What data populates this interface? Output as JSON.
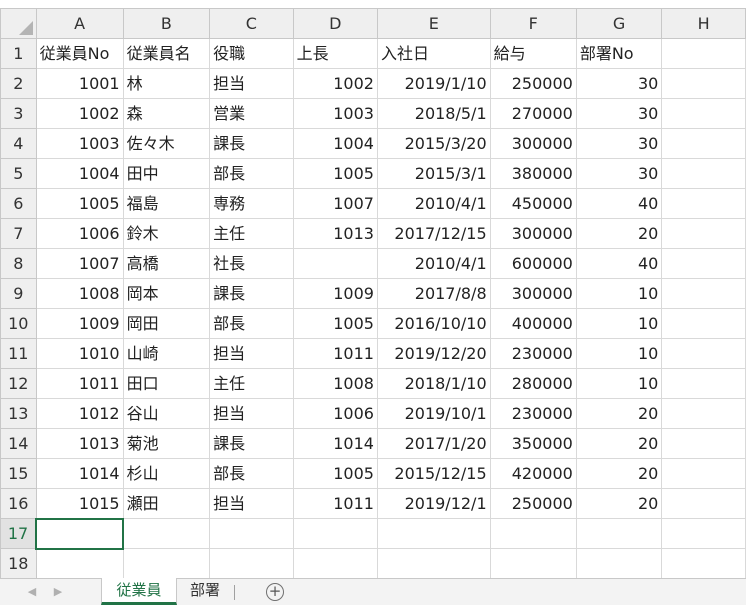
{
  "columns": [
    "A",
    "B",
    "C",
    "D",
    "E",
    "F",
    "G",
    "H"
  ],
  "rows": [
    {
      "num": "1",
      "cells": [
        "従業員No",
        "従業員名",
        "役職",
        "上長",
        "入社日",
        "給与",
        "部署No",
        ""
      ]
    },
    {
      "num": "2",
      "cells": [
        "1001",
        "林",
        "担当",
        "1002",
        "2019/1/10",
        "250000",
        "30",
        ""
      ]
    },
    {
      "num": "3",
      "cells": [
        "1002",
        "森",
        "営業",
        "1003",
        "2018/5/1",
        "270000",
        "30",
        ""
      ]
    },
    {
      "num": "4",
      "cells": [
        "1003",
        "佐々木",
        "課長",
        "1004",
        "2015/3/20",
        "300000",
        "30",
        ""
      ]
    },
    {
      "num": "5",
      "cells": [
        "1004",
        "田中",
        "部長",
        "1005",
        "2015/3/1",
        "380000",
        "30",
        ""
      ]
    },
    {
      "num": "6",
      "cells": [
        "1005",
        "福島",
        "専務",
        "1007",
        "2010/4/1",
        "450000",
        "40",
        ""
      ]
    },
    {
      "num": "7",
      "cells": [
        "1006",
        "鈴木",
        "主任",
        "1013",
        "2017/12/15",
        "300000",
        "20",
        ""
      ]
    },
    {
      "num": "8",
      "cells": [
        "1007",
        "高橋",
        "社長",
        "",
        "2010/4/1",
        "600000",
        "40",
        ""
      ]
    },
    {
      "num": "9",
      "cells": [
        "1008",
        "岡本",
        "課長",
        "1009",
        "2017/8/8",
        "300000",
        "10",
        ""
      ]
    },
    {
      "num": "10",
      "cells": [
        "1009",
        "岡田",
        "部長",
        "1005",
        "2016/10/10",
        "400000",
        "10",
        ""
      ]
    },
    {
      "num": "11",
      "cells": [
        "1010",
        "山崎",
        "担当",
        "1011",
        "2019/12/20",
        "230000",
        "10",
        ""
      ]
    },
    {
      "num": "12",
      "cells": [
        "1011",
        "田口",
        "主任",
        "1008",
        "2018/1/10",
        "280000",
        "10",
        ""
      ]
    },
    {
      "num": "13",
      "cells": [
        "1012",
        "谷山",
        "担当",
        "1006",
        "2019/10/1",
        "230000",
        "20",
        ""
      ]
    },
    {
      "num": "14",
      "cells": [
        "1013",
        "菊池",
        "課長",
        "1014",
        "2017/1/20",
        "350000",
        "20",
        ""
      ]
    },
    {
      "num": "15",
      "cells": [
        "1014",
        "杉山",
        "部長",
        "1005",
        "2015/12/15",
        "420000",
        "20",
        ""
      ]
    },
    {
      "num": "16",
      "cells": [
        "1015",
        "瀬田",
        "担当",
        "1011",
        "2019/12/1",
        "250000",
        "20",
        ""
      ]
    },
    {
      "num": "17",
      "cells": [
        "",
        "",
        "",
        "",
        "",
        "",
        "",
        ""
      ]
    },
    {
      "num": "18",
      "cells": [
        "",
        "",
        "",
        "",
        "",
        "",
        "",
        ""
      ]
    }
  ],
  "active_row": "17",
  "sheet_tabs": [
    {
      "label": "従業員",
      "active": true
    },
    {
      "label": "部署",
      "active": false
    }
  ],
  "add_sheet_glyph": "+",
  "nav": {
    "prev": "◀",
    "next": "▶"
  },
  "accent_color": "#217346"
}
